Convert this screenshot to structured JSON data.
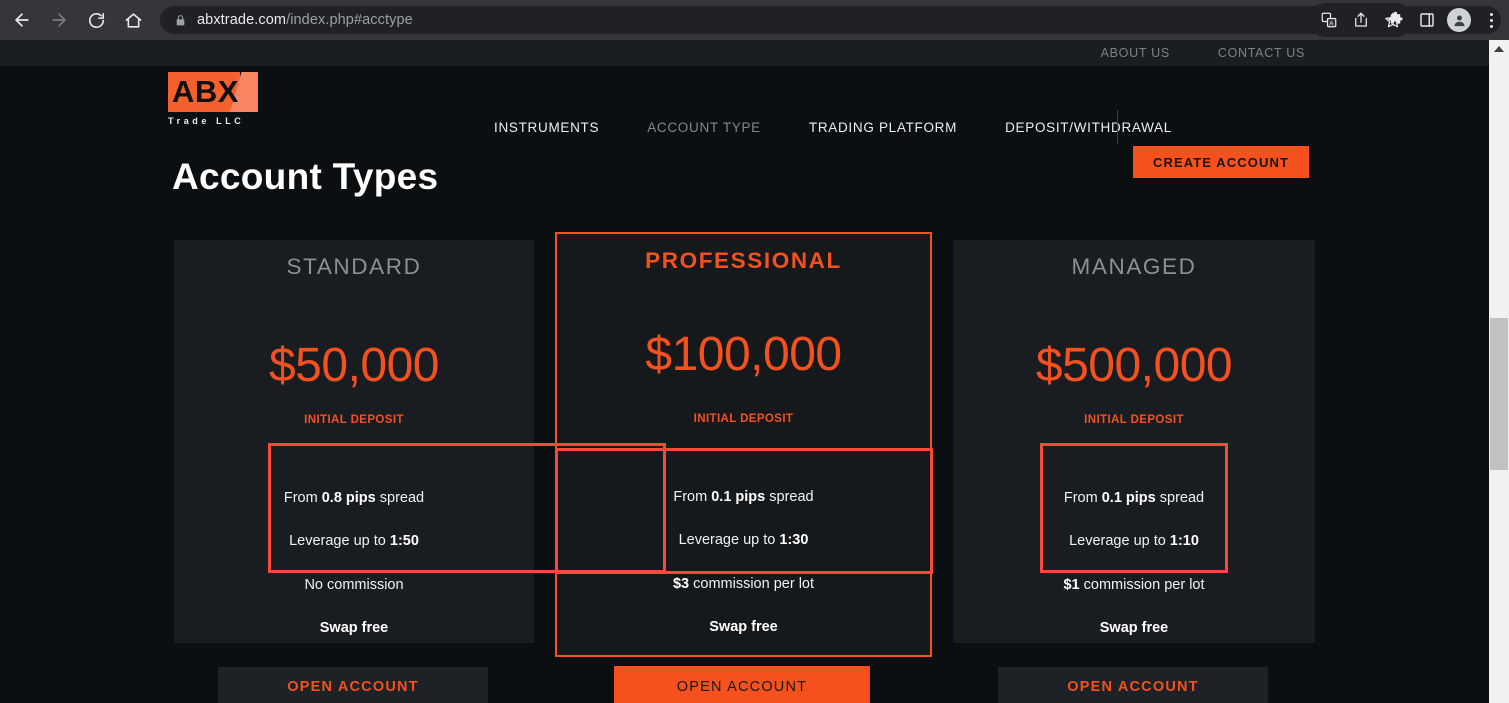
{
  "browser": {
    "url_host": "abxtrade.com",
    "url_path": "/index.php#acctype",
    "back_icon": "back-arrow-icon",
    "forward_icon": "forward-arrow-icon",
    "reload_icon": "reload-icon",
    "home_icon": "home-icon",
    "lock_icon": "lock-icon",
    "translate_icon": "translate-icon",
    "share_icon": "share-icon",
    "bookmark_icon": "star-icon",
    "extensions_icon": "puzzle-icon",
    "sidepanel_icon": "side-panel-icon",
    "profile_icon": "profile-avatar-icon",
    "menu_icon": "three-dot-menu-icon"
  },
  "site": {
    "utility_links": [
      "ABOUT US",
      "CONTACT US"
    ],
    "logo": {
      "mark": "ABX",
      "sub": "Trade LLC"
    },
    "nav": [
      {
        "label": "INSTRUMENTS",
        "active": false
      },
      {
        "label": "ACCOUNT TYPE",
        "active": true
      },
      {
        "label": "TRADING PLATFORM",
        "active": false
      },
      {
        "label": "DEPOSIT/WITHDRAWAL",
        "active": false
      }
    ],
    "create_account_label": "CREATE ACCOUNT",
    "page_title": "Account Types",
    "accent_color": "#f4511e",
    "annotation_color": "#f9483c",
    "card_bg": "#191d21",
    "page_bg": "#0c0f11"
  },
  "cards": [
    {
      "title": "STANDARD",
      "price": "$50,000",
      "price_label": "INITIAL DEPOSIT",
      "features": [
        {
          "pre": "From ",
          "strong": "0.8 pips",
          "post": " spread"
        },
        {
          "pre": "Leverage up to ",
          "strong": "1:50",
          "post": ""
        },
        {
          "pre": "",
          "strong": "",
          "post": "No commission"
        }
      ],
      "swap": "Swap free",
      "cta_label": "OPEN ACCOUNT",
      "highlighted": false
    },
    {
      "title": "PROFESSIONAL",
      "price": "$100,000",
      "price_label": "INITIAL DEPOSIT",
      "features": [
        {
          "pre": "From ",
          "strong": "0.1 pips",
          "post": " spread"
        },
        {
          "pre": "Leverage up to ",
          "strong": "1:30",
          "post": ""
        },
        {
          "pre": "",
          "strong": "$3",
          "post": " commission per lot"
        }
      ],
      "swap": "Swap free",
      "cta_label": "OPEN ACCOUNT",
      "highlighted": true
    },
    {
      "title": "MANAGED",
      "price": "$500,000",
      "price_label": "INITIAL DEPOSIT",
      "features": [
        {
          "pre": "From ",
          "strong": "0.1 pips",
          "post": " spread"
        },
        {
          "pre": "Leverage up to ",
          "strong": "1:10",
          "post": ""
        },
        {
          "pre": "",
          "strong": "$1",
          "post": " commission per lot"
        }
      ],
      "swap": "Swap free",
      "cta_label": "OPEN ACCOUNT",
      "highlighted": false
    }
  ],
  "scrollbar": {
    "up_arrow_icon": "caret-up-icon"
  }
}
